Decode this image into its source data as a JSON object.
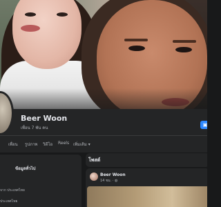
{
  "profile": {
    "name": "Beer Woon",
    "friends_count": "เพื่อน 7 พัน คน"
  },
  "tabs": [
    {
      "label": "เพื่อน"
    },
    {
      "label": "รูปภาพ"
    },
    {
      "label": "วิดีโอ"
    },
    {
      "label": "Reels"
    },
    {
      "label": "เพิ่มเติม ▾"
    }
  ],
  "intro": {
    "title": "ข้อมูลทั่วไป",
    "lines": [
      "จาก ประเทศไทย",
      "ประเทศไทย"
    ]
  },
  "posts": {
    "header": "โพสต์",
    "items": [
      {
        "author": "Beer Woon",
        "time": "14 ชม. · ◍"
      }
    ]
  },
  "icons": {
    "camera": "camera-icon"
  },
  "colors": {
    "accent": "#2d88ff",
    "background": "#18191a",
    "card": "#242526"
  }
}
